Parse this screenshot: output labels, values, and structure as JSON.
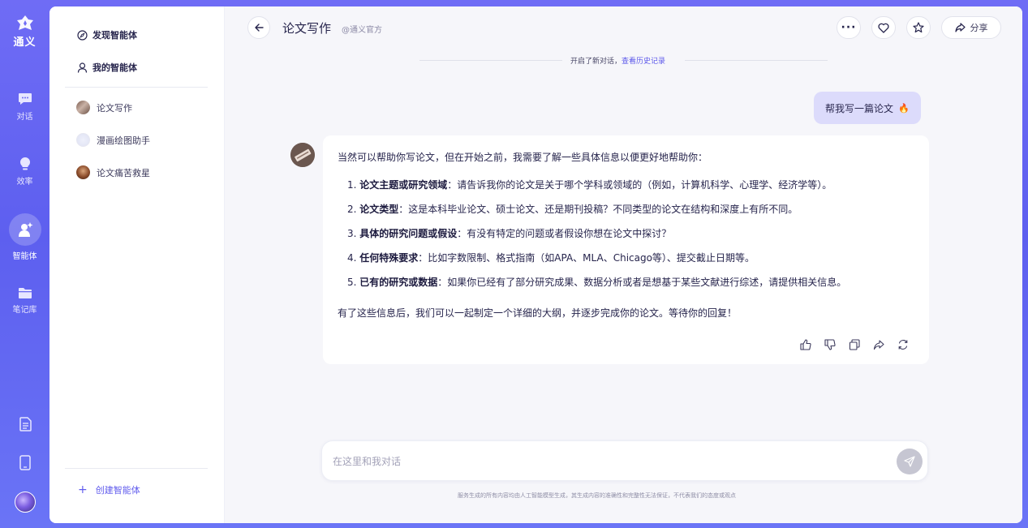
{
  "rail": {
    "logo_text": "通义",
    "items": [
      {
        "label": "对话",
        "icon": "chat-bubble-icon"
      },
      {
        "label": "效率",
        "icon": "lightbulb-icon"
      },
      {
        "label": "智能体",
        "icon": "agent-icon"
      },
      {
        "label": "笔记库",
        "icon": "folder-icon"
      }
    ]
  },
  "sidebar": {
    "discover": "发现智能体",
    "mine": "我的智能体",
    "agents": [
      {
        "name": "论文写作"
      },
      {
        "name": "漫画绘图助手"
      },
      {
        "name": "论文痛苦救星"
      }
    ],
    "create": "创建智能体"
  },
  "header": {
    "title": "论文写作",
    "official": "@通义官方",
    "share": "分享"
  },
  "separator": {
    "text": "开启了新对话，",
    "link": "查看历史记录"
  },
  "user_message": {
    "text": "帮我写一篇论文",
    "emoji": "🔥"
  },
  "bot_message": {
    "intro": "当然可以帮助你写论文，但在开始之前，我需要了解一些具体信息以便更好地帮助你：",
    "items": [
      {
        "num": "1.",
        "title": "论文主题或研究领域",
        "text": "：请告诉我你的论文是关于哪个学科或领域的（例如，计算机科学、心理学、经济学等）。"
      },
      {
        "num": "2.",
        "title": "论文类型",
        "text": "：这是本科毕业论文、硕士论文、还是期刊投稿？不同类型的论文在结构和深度上有所不同。"
      },
      {
        "num": "3.",
        "title": "具体的研究问题或假设",
        "text": "：有没有特定的问题或者假设你想在论文中探讨？"
      },
      {
        "num": "4.",
        "title": "任何特殊要求",
        "text": "：比如字数限制、格式指南（如APA、MLA、Chicago等）、提交截止日期等。"
      },
      {
        "num": "5.",
        "title": "已有的研究或数据",
        "text": "：如果你已经有了部分研究成果、数据分析或者是想基于某些文献进行综述，请提供相关信息。"
      }
    ],
    "outro": "有了这些信息后，我们可以一起制定一个详细的大纲，并逐步完成你的论文。等待你的回复！"
  },
  "composer": {
    "placeholder": "在这里和我对话"
  },
  "disclaimer": "服务生成的所有内容均由人工智能模型生成，其生成内容的准确性和完整性无法保证，不代表我们的态度或观点"
}
